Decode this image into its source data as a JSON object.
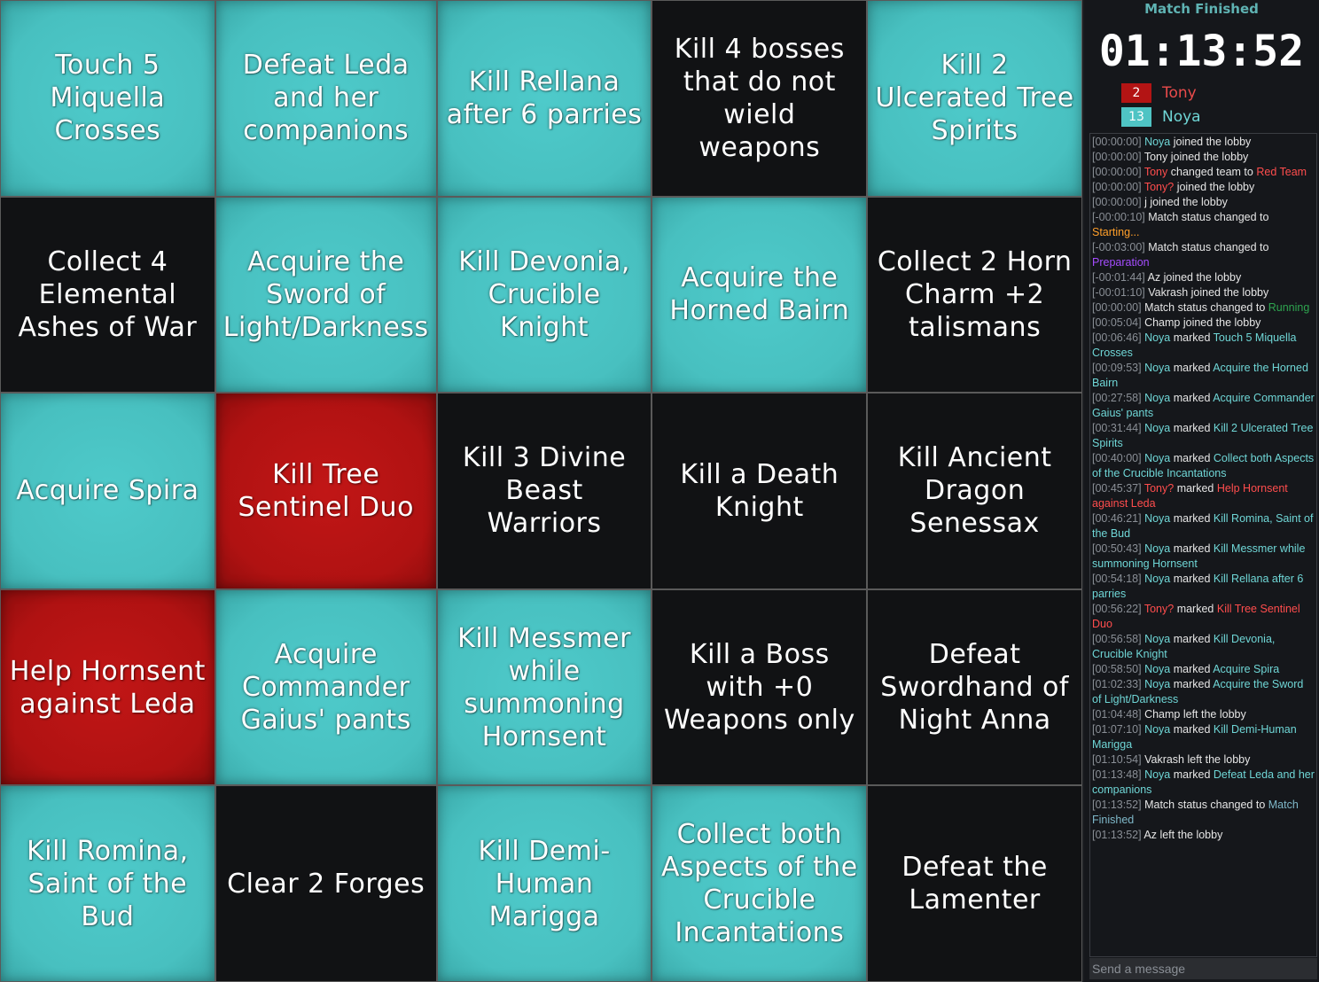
{
  "board": [
    {
      "text": "Touch 5 Miquella Crosses",
      "state": "teal"
    },
    {
      "text": "Defeat Leda and her companions",
      "state": "teal"
    },
    {
      "text": "Kill Rellana after 6 parries",
      "state": "teal"
    },
    {
      "text": "Kill 4 bosses that do not wield weapons",
      "state": "blank"
    },
    {
      "text": "Kill 2 Ulcerated Tree Spirits",
      "state": "teal"
    },
    {
      "text": "Collect 4 Elemental Ashes of War",
      "state": "blank"
    },
    {
      "text": "Acquire the Sword of Light/Darkness",
      "state": "teal"
    },
    {
      "text": "Kill Devonia, Crucible Knight",
      "state": "teal"
    },
    {
      "text": "Acquire the Horned Bairn",
      "state": "teal"
    },
    {
      "text": "Collect 2 Horn Charm +2 talismans",
      "state": "blank"
    },
    {
      "text": "Acquire Spira",
      "state": "teal"
    },
    {
      "text": "Kill Tree Sentinel Duo",
      "state": "red"
    },
    {
      "text": "Kill 3 Divine Beast Warriors",
      "state": "blank"
    },
    {
      "text": "Kill a Death Knight",
      "state": "blank"
    },
    {
      "text": "Kill Ancient Dragon Senessax",
      "state": "blank"
    },
    {
      "text": "Help Hornsent against Leda",
      "state": "red"
    },
    {
      "text": "Acquire Commander Gaius' pants",
      "state": "teal"
    },
    {
      "text": "Kill Messmer while summoning Hornsent",
      "state": "teal"
    },
    {
      "text": "Kill a Boss with +0 Weapons only",
      "state": "blank"
    },
    {
      "text": "Defeat Swordhand of Night Anna",
      "state": "blank"
    },
    {
      "text": "Kill Romina, Saint of the Bud",
      "state": "teal"
    },
    {
      "text": "Clear 2 Forges",
      "state": "blank"
    },
    {
      "text": "Kill Demi-Human Marigga",
      "state": "teal"
    },
    {
      "text": "Collect both Aspects of the Crucible Incantations",
      "state": "teal"
    },
    {
      "text": "Defeat the Lamenter",
      "state": "blank"
    }
  ],
  "sidebar": {
    "status": "Match Finished",
    "timer": "01:13:52",
    "teams": [
      {
        "count": "2",
        "player": "Tony",
        "color": "#b31414"
      },
      {
        "count": "13",
        "player": "Noya",
        "color": "#4fc4c4"
      }
    ],
    "chat_placeholder": "Send a message"
  },
  "log": [
    [
      [
        "[00:00:00] ",
        "ts"
      ],
      [
        "Noya",
        "cn"
      ],
      [
        " joined the lobby",
        "cw"
      ]
    ],
    [
      [
        "[00:00:00] ",
        "ts"
      ],
      [
        "Tony joined the lobby",
        "cw"
      ]
    ],
    [
      [
        "[00:00:00] ",
        "ts"
      ],
      [
        "Tony",
        "cr"
      ],
      [
        " changed team to ",
        "cw"
      ],
      [
        "Red Team",
        "cr"
      ]
    ],
    [
      [
        "[00:00:00] ",
        "ts"
      ],
      [
        "Tony?",
        "cr"
      ],
      [
        " joined the lobby",
        "cw"
      ]
    ],
    [
      [
        "[00:00:00] ",
        "ts"
      ],
      [
        "j joined the lobby",
        "cw"
      ]
    ],
    [
      [
        "[-00:00:10] ",
        "ts"
      ],
      [
        "Match status changed to ",
        "cw"
      ],
      [
        "Starting...",
        "co"
      ]
    ],
    [
      [
        "[-00:03:00] ",
        "ts"
      ],
      [
        "Match status changed to ",
        "cw"
      ],
      [
        "Preparation",
        "cp"
      ]
    ],
    [
      [
        "[-00:01:44] ",
        "ts"
      ],
      [
        "Az joined the lobby",
        "cw"
      ]
    ],
    [
      [
        "[-00:01:10] ",
        "ts"
      ],
      [
        "Vakrash joined the lobby",
        "cw"
      ]
    ],
    [
      [
        "[00:00:00] ",
        "ts"
      ],
      [
        "Match status changed to ",
        "cw"
      ],
      [
        "Running",
        "cg"
      ]
    ],
    [
      [
        "[00:05:04] ",
        "ts"
      ],
      [
        "Champ joined the lobby",
        "cw"
      ]
    ],
    [
      [
        "[00:06:46] ",
        "ts"
      ],
      [
        "Noya",
        "cn"
      ],
      [
        " marked ",
        "cw"
      ],
      [
        "Touch 5 Miquella Crosses",
        "cn"
      ]
    ],
    [
      [
        "[00:09:53] ",
        "ts"
      ],
      [
        "Noya",
        "cn"
      ],
      [
        " marked ",
        "cw"
      ],
      [
        "Acquire the Horned Bairn",
        "cn"
      ]
    ],
    [
      [
        "[00:27:58] ",
        "ts"
      ],
      [
        "Noya",
        "cn"
      ],
      [
        " marked ",
        "cw"
      ],
      [
        "Acquire Commander Gaius' pants",
        "cn"
      ]
    ],
    [
      [
        "[00:31:44] ",
        "ts"
      ],
      [
        "Noya",
        "cn"
      ],
      [
        " marked ",
        "cw"
      ],
      [
        "Kill 2 Ulcerated Tree Spirits",
        "cn"
      ]
    ],
    [
      [
        "[00:40:00] ",
        "ts"
      ],
      [
        "Noya",
        "cn"
      ],
      [
        " marked ",
        "cw"
      ],
      [
        "Collect both Aspects of the Crucible Incantations",
        "cn"
      ]
    ],
    [
      [
        "[00:45:37] ",
        "ts"
      ],
      [
        "Tony?",
        "cr"
      ],
      [
        " marked ",
        "cw"
      ],
      [
        "Help Hornsent against Leda",
        "cr"
      ]
    ],
    [
      [
        "[00:46:21] ",
        "ts"
      ],
      [
        "Noya",
        "cn"
      ],
      [
        " marked ",
        "cw"
      ],
      [
        "Kill Romina, Saint of the Bud",
        "cn"
      ]
    ],
    [
      [
        "[00:50:43] ",
        "ts"
      ],
      [
        "Noya",
        "cn"
      ],
      [
        " marked ",
        "cw"
      ],
      [
        "Kill Messmer while summoning Hornsent",
        "cn"
      ]
    ],
    [
      [
        "[00:54:18] ",
        "ts"
      ],
      [
        "Noya",
        "cn"
      ],
      [
        " marked ",
        "cw"
      ],
      [
        "Kill Rellana after 6 parries",
        "cn"
      ]
    ],
    [
      [
        "[00:56:22] ",
        "ts"
      ],
      [
        "Tony?",
        "cr"
      ],
      [
        " marked ",
        "cw"
      ],
      [
        "Kill Tree Sentinel Duo",
        "cr"
      ]
    ],
    [
      [
        "[00:56:58] ",
        "ts"
      ],
      [
        "Noya",
        "cn"
      ],
      [
        " marked ",
        "cw"
      ],
      [
        "Kill Devonia, Crucible Knight",
        "cn"
      ]
    ],
    [
      [
        "[00:58:50] ",
        "ts"
      ],
      [
        "Noya",
        "cn"
      ],
      [
        " marked ",
        "cw"
      ],
      [
        "Acquire Spira",
        "cn"
      ]
    ],
    [
      [
        "[01:02:33] ",
        "ts"
      ],
      [
        "Noya",
        "cn"
      ],
      [
        " marked ",
        "cw"
      ],
      [
        "Acquire the Sword of Light/Darkness",
        "cn"
      ]
    ],
    [
      [
        "[01:04:48] ",
        "ts"
      ],
      [
        "Champ left the lobby",
        "cw"
      ]
    ],
    [
      [
        "[01:07:10] ",
        "ts"
      ],
      [
        "Noya",
        "cn"
      ],
      [
        " marked ",
        "cw"
      ],
      [
        "Kill Demi-Human Marigga",
        "cn"
      ]
    ],
    [
      [
        "[01:10:54] ",
        "ts"
      ],
      [
        "Vakrash left the lobby",
        "cw"
      ]
    ],
    [
      [
        "[01:13:48] ",
        "ts"
      ],
      [
        "Noya",
        "cn"
      ],
      [
        " marked ",
        "cw"
      ],
      [
        "Defeat Leda and her companions",
        "cn"
      ]
    ],
    [
      [
        "[01:13:52] ",
        "ts"
      ],
      [
        "Match status changed to ",
        "cw"
      ],
      [
        "Match Finished",
        "ck"
      ]
    ],
    [
      [
        "[01:13:52] ",
        "ts"
      ],
      [
        "Az left the lobby",
        "cw"
      ]
    ]
  ]
}
